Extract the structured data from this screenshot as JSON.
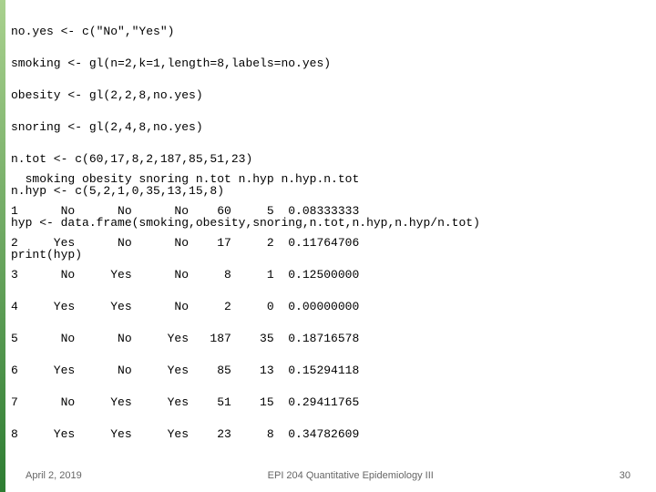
{
  "code": {
    "l1": "no.yes <- c(\"No\",\"Yes\")",
    "l2": "smoking <- gl(n=2,k=1,length=8,labels=no.yes)",
    "l3": "obesity <- gl(2,2,8,no.yes)",
    "l4": "snoring <- gl(2,4,8,no.yes)",
    "l5": "n.tot <- c(60,17,8,2,187,85,51,23)",
    "l6": "n.hyp <- c(5,2,1,0,35,13,15,8)",
    "l7": "hyp <- data.frame(smoking,obesity,snoring,n.tot,n.hyp,n.hyp/n.tot)",
    "l8": "print(hyp)"
  },
  "table": {
    "header": "  smoking obesity snoring n.tot n.hyp n.hyp.n.tot",
    "r1": "1      No      No      No    60     5  0.08333333",
    "r2": "2     Yes      No      No    17     2  0.11764706",
    "r3": "3      No     Yes      No     8     1  0.12500000",
    "r4": "4     Yes     Yes      No     2     0  0.00000000",
    "r5": "5      No      No     Yes   187    35  0.18716578",
    "r6": "6     Yes      No     Yes    85    13  0.15294118",
    "r7": "7      No     Yes     Yes    51    15  0.29411765",
    "r8": "8     Yes     Yes     Yes    23     8  0.34782609"
  },
  "footer": {
    "date": "April 2, 2019",
    "title": "EPI 204 Quantitative Epidemiology III",
    "page": "30"
  },
  "chart_data": {
    "type": "table",
    "columns": [
      "smoking",
      "obesity",
      "snoring",
      "n.tot",
      "n.hyp",
      "n.hyp.n.tot"
    ],
    "rows": [
      {
        "row": 1,
        "smoking": "No",
        "obesity": "No",
        "snoring": "No",
        "n.tot": 60,
        "n.hyp": 5,
        "n.hyp.n.tot": 0.08333333
      },
      {
        "row": 2,
        "smoking": "Yes",
        "obesity": "No",
        "snoring": "No",
        "n.tot": 17,
        "n.hyp": 2,
        "n.hyp.n.tot": 0.11764706
      },
      {
        "row": 3,
        "smoking": "No",
        "obesity": "Yes",
        "snoring": "No",
        "n.tot": 8,
        "n.hyp": 1,
        "n.hyp.n.tot": 0.125
      },
      {
        "row": 4,
        "smoking": "Yes",
        "obesity": "Yes",
        "snoring": "No",
        "n.tot": 2,
        "n.hyp": 0,
        "n.hyp.n.tot": 0.0
      },
      {
        "row": 5,
        "smoking": "No",
        "obesity": "No",
        "snoring": "Yes",
        "n.tot": 187,
        "n.hyp": 35,
        "n.hyp.n.tot": 0.18716578
      },
      {
        "row": 6,
        "smoking": "Yes",
        "obesity": "No",
        "snoring": "Yes",
        "n.tot": 85,
        "n.hyp": 13,
        "n.hyp.n.tot": 0.15294118
      },
      {
        "row": 7,
        "smoking": "No",
        "obesity": "Yes",
        "snoring": "Yes",
        "n.tot": 51,
        "n.hyp": 15,
        "n.hyp.n.tot": 0.29411765
      },
      {
        "row": 8,
        "smoking": "Yes",
        "obesity": "Yes",
        "snoring": "Yes",
        "n.tot": 23,
        "n.hyp": 8,
        "n.hyp.n.tot": 0.34782609
      }
    ]
  }
}
